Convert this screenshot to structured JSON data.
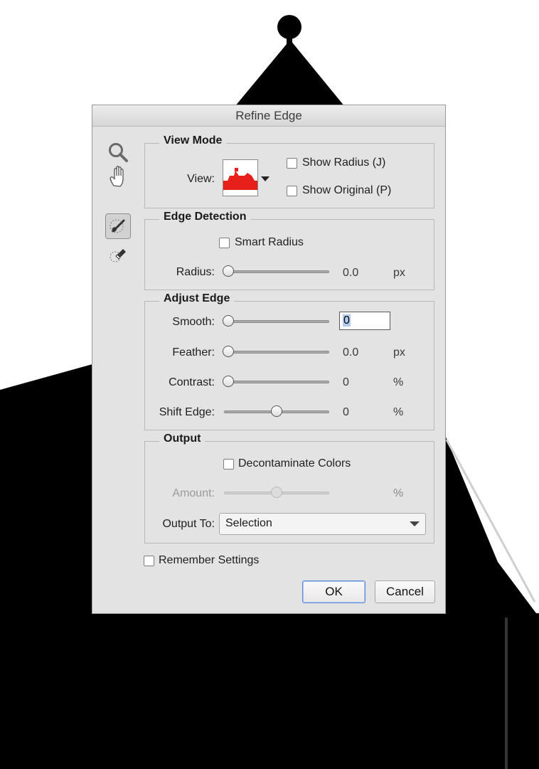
{
  "dialog": {
    "title": "Refine Edge",
    "tools": [
      {
        "icon": "zoom-icon",
        "active": false
      },
      {
        "icon": "hand-icon",
        "active": false
      },
      {
        "icon": "refine-radius-brush-icon",
        "active": true
      },
      {
        "icon": "erase-refinements-icon",
        "active": false
      }
    ],
    "view_mode": {
      "title": "View Mode",
      "view_label": "View:",
      "show_radius": {
        "label": "Show Radius (J)",
        "checked": false
      },
      "show_original": {
        "label": "Show Original (P)",
        "checked": false
      }
    },
    "edge_detection": {
      "title": "Edge Detection",
      "smart_radius": {
        "label": "Smart Radius",
        "checked": false
      },
      "radius": {
        "label": "Radius:",
        "value": "0.0",
        "unit": "px",
        "slider_fraction": 0.0
      }
    },
    "adjust_edge": {
      "title": "Adjust Edge",
      "smooth": {
        "label": "Smooth:",
        "value": "0",
        "slider_fraction": 0.0
      },
      "feather": {
        "label": "Feather:",
        "value": "0.0",
        "unit": "px",
        "slider_fraction": 0.0
      },
      "contrast": {
        "label": "Contrast:",
        "value": "0",
        "unit": "%",
        "slider_fraction": 0.0
      },
      "shift_edge": {
        "label": "Shift Edge:",
        "value": "0",
        "unit": "%",
        "slider_fraction": 0.5
      }
    },
    "output": {
      "title": "Output",
      "decontaminate": {
        "label": "Decontaminate Colors",
        "checked": false
      },
      "amount": {
        "label": "Amount:",
        "unit": "%",
        "disabled": true,
        "slider_fraction": 0.5
      },
      "output_to": {
        "label": "Output To:",
        "selected": "Selection"
      }
    },
    "remember_settings": {
      "label": "Remember Settings",
      "checked": false
    },
    "buttons": {
      "ok": "OK",
      "cancel": "Cancel"
    }
  }
}
